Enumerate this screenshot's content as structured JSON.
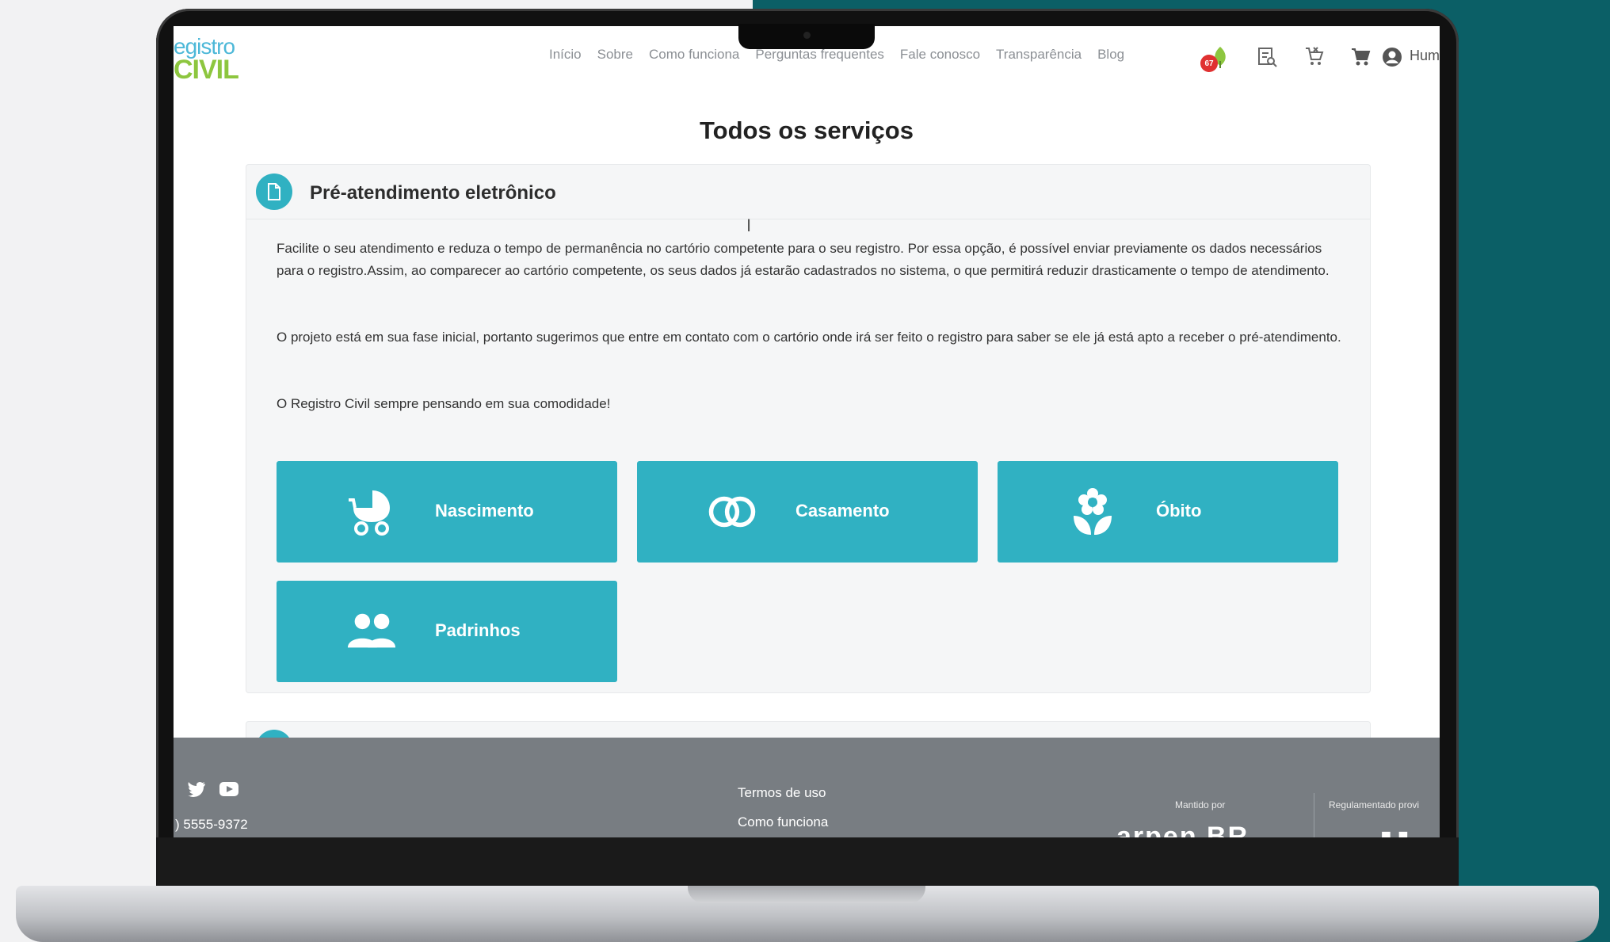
{
  "header": {
    "logo_top": "egistro",
    "logo_bottom": "CIVIL",
    "nav": [
      "Início",
      "Sobre",
      "Como funciona",
      "Perguntas frequentes",
      "Fale conosco",
      "Transparência",
      "Blog"
    ],
    "notification_count": "67",
    "user_name": "Hum"
  },
  "main": {
    "title": "Todos os serviços",
    "card": {
      "title": "Pré-atendimento eletrônico",
      "paragraphs": [
        "Facilite o seu atendimento e reduza o tempo de permanência no cartório competente para o seu registro. Por essa opção, é possível enviar previamente os dados necessários para o registro.Assim, ao comparecer ao cartório competente, os seus dados já estarão cadastrados no sistema, o que permitirá reduzir drasticamente o tempo de atendimento.",
        "O projeto está em sua fase inicial, portanto sugerimos que entre em contato com o cartório onde irá ser feito o registro para saber se ele já está apto a receber o pré-atendimento.",
        "O Registro Civil sempre pensando em sua comodidade!"
      ],
      "services": [
        {
          "label": "Nascimento",
          "icon": "baby-carriage-icon"
        },
        {
          "label": "Casamento",
          "icon": "rings-icon"
        },
        {
          "label": "Óbito",
          "icon": "flower-icon"
        },
        {
          "label": "Padrinhos",
          "icon": "users-icon"
        }
      ]
    }
  },
  "footer": {
    "phone": ") 5555-9372",
    "links": [
      "Termos de uso",
      "Como funciona"
    ],
    "maintained_by": "Mantido por",
    "regulated_by": "Regulamentado provi",
    "maintainer_logo": "arpen BR"
  },
  "colors": {
    "accent": "#30b1c2",
    "footer": "#787d82",
    "teal_background": "#0b5f66"
  }
}
